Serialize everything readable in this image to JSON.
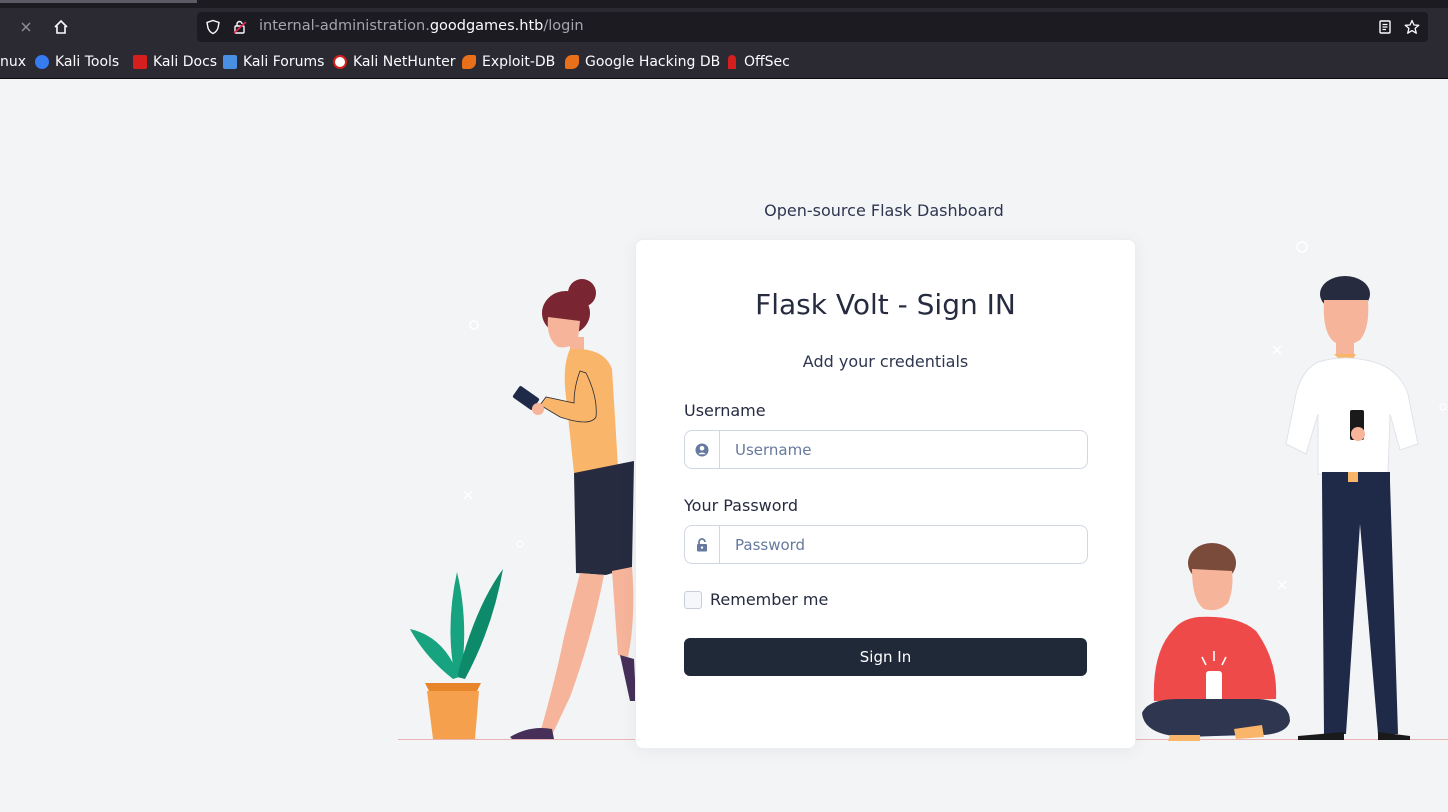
{
  "browser": {
    "url": {
      "prefix": "internal-administration.",
      "host": "goodgames.htb",
      "path": "/login"
    },
    "bookmarks": [
      {
        "label": "nux",
        "icon": "kali-linux-icon",
        "color": ""
      },
      {
        "label": "Kali Tools",
        "icon": "kali-tools-icon",
        "color": "#367bf0"
      },
      {
        "label": "Kali Docs",
        "icon": "kali-docs-icon",
        "color": "#d51f1f"
      },
      {
        "label": "Kali Forums",
        "icon": "kali-forums-icon",
        "color": "#4a90e2"
      },
      {
        "label": "Kali NetHunter",
        "icon": "kali-nethunter-icon",
        "color": "#d51f1f"
      },
      {
        "label": "Exploit-DB",
        "icon": "exploit-db-icon",
        "color": "#e8701a"
      },
      {
        "label": "Google Hacking DB",
        "icon": "ghdb-icon",
        "color": "#e8701a"
      },
      {
        "label": "OffSec",
        "icon": "offsec-icon",
        "color": "#d51f1f"
      }
    ]
  },
  "page": {
    "subtitle": "Open-source Flask Dashboard",
    "card": {
      "title": "Flask Volt - Sign IN",
      "subtitle": "Add your credentials",
      "username": {
        "label": "Username",
        "placeholder": "Username"
      },
      "password": {
        "label": "Your Password",
        "placeholder": "Password"
      },
      "remember_label": "Remember me",
      "submit_label": "Sign In"
    }
  },
  "colors": {
    "primary": "#1f2937",
    "page_bg": "#f3f4f6",
    "browser_chrome": "#2b2a33"
  }
}
